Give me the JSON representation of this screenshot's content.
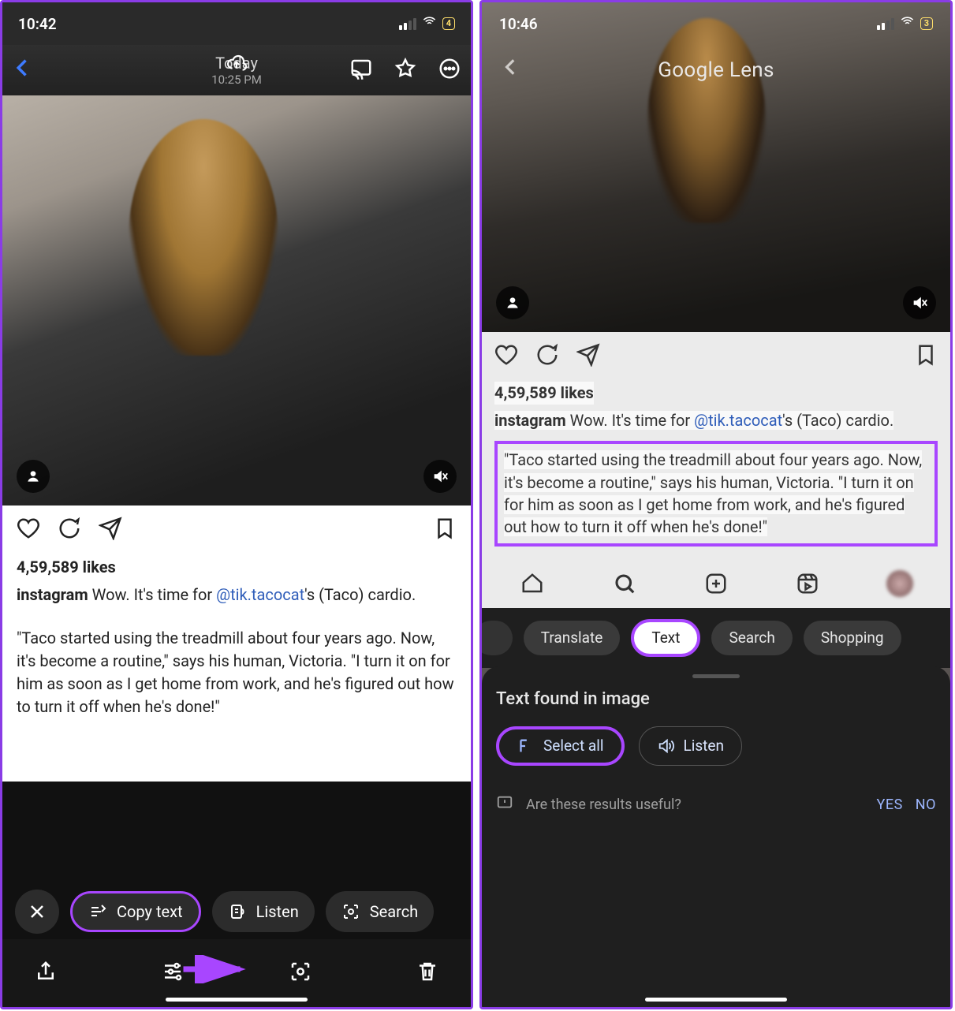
{
  "left": {
    "status": {
      "time": "10:42",
      "battery": "4"
    },
    "topbar": {
      "title": "Today",
      "subtitle": "10:25 PM"
    },
    "ig": {
      "likes": "4,59,589 likes",
      "username": "instagram",
      "caption_lead": " Wow. It's time for ",
      "mention": "@tik.tacocat",
      "caption_tail": "'s (Taco) cardio.",
      "quote": "\"Taco started using the treadmill about four years ago. Now, it's become a routine,\" says his human, Victoria. \"I turn it on for him as soon as I get home from work, and he's figured out how to turn it off when he's done!\""
    },
    "lens": {
      "copy": "Copy text",
      "listen": "Listen",
      "search": "Search"
    }
  },
  "right": {
    "status": {
      "time": "10:46",
      "battery": "3"
    },
    "title": "Google Lens",
    "ig": {
      "likes": "4,59,589 likes",
      "username": "instagram",
      "caption_lead": " Wow. It's time for ",
      "mention": "@tik.tacocat",
      "caption_tail": "'s (Taco) cardio.",
      "quote": "\"Taco started using the treadmill about four years ago. Now, it's become a routine,\" says his human, Victoria. \"I turn it on for him as soon as I get home from work, and he's figured out how to turn it off when he's done!\""
    },
    "chips": {
      "translate": "Translate",
      "text": "Text",
      "search": "Search",
      "shopping": "Shopping"
    },
    "sheet": {
      "heading": "Text found in image",
      "select_all": "Select all",
      "listen": "Listen",
      "feedback_q": "Are these results useful?",
      "yes": "YES",
      "no": "NO"
    }
  }
}
